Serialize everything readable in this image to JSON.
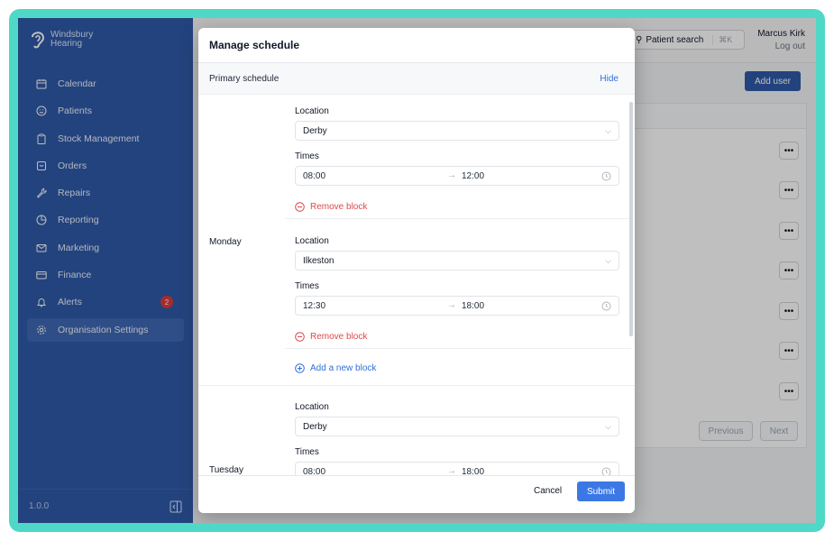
{
  "brand": {
    "line1": "Windsbury",
    "line2": "Hearing"
  },
  "sidebar": {
    "items": [
      {
        "label": "Calendar",
        "icon": "calendar-icon"
      },
      {
        "label": "Patients",
        "icon": "smiley-icon"
      },
      {
        "label": "Stock Management",
        "icon": "clipboard-icon"
      },
      {
        "label": "Orders",
        "icon": "inbox-icon"
      },
      {
        "label": "Repairs",
        "icon": "wrench-icon"
      },
      {
        "label": "Reporting",
        "icon": "pie-chart-icon"
      },
      {
        "label": "Marketing",
        "icon": "mail-icon"
      },
      {
        "label": "Finance",
        "icon": "credit-card-icon"
      },
      {
        "label": "Alerts",
        "icon": "bell-icon",
        "badge": "2"
      },
      {
        "label": "Organisation Settings",
        "icon": "gear-icon",
        "active": true
      }
    ],
    "version": "1.0.0"
  },
  "topbar": {
    "search_label": "Patient search",
    "search_shortcut": "⌘K",
    "user_name": "Marcus Kirk",
    "logout": "Log out"
  },
  "page": {
    "add_user": "Add user",
    "pagination": {
      "previous": "Previous",
      "next": "Next"
    }
  },
  "modal": {
    "title": "Manage schedule",
    "section_title": "Primary schedule",
    "hide_label": "Hide",
    "location_label": "Location",
    "times_label": "Times",
    "remove_block_label": "Remove block",
    "add_block_label": "Add a new block",
    "days": [
      {
        "name": "Monday",
        "blocks": [
          {
            "location": "Derby",
            "start": "08:00",
            "end": "12:00"
          },
          {
            "location": "Ilkeston",
            "start": "12:30",
            "end": "18:00"
          }
        ]
      },
      {
        "name": "Tuesday",
        "blocks": [
          {
            "location": "Derby",
            "start": "08:00",
            "end": "18:00"
          }
        ]
      }
    ],
    "cancel": "Cancel",
    "submit": "Submit"
  },
  "colors": {
    "sidebar": "#2f5aa8",
    "accent": "#3b78e6",
    "danger": "#dc4a4a",
    "frame": "#4fd8c8"
  }
}
